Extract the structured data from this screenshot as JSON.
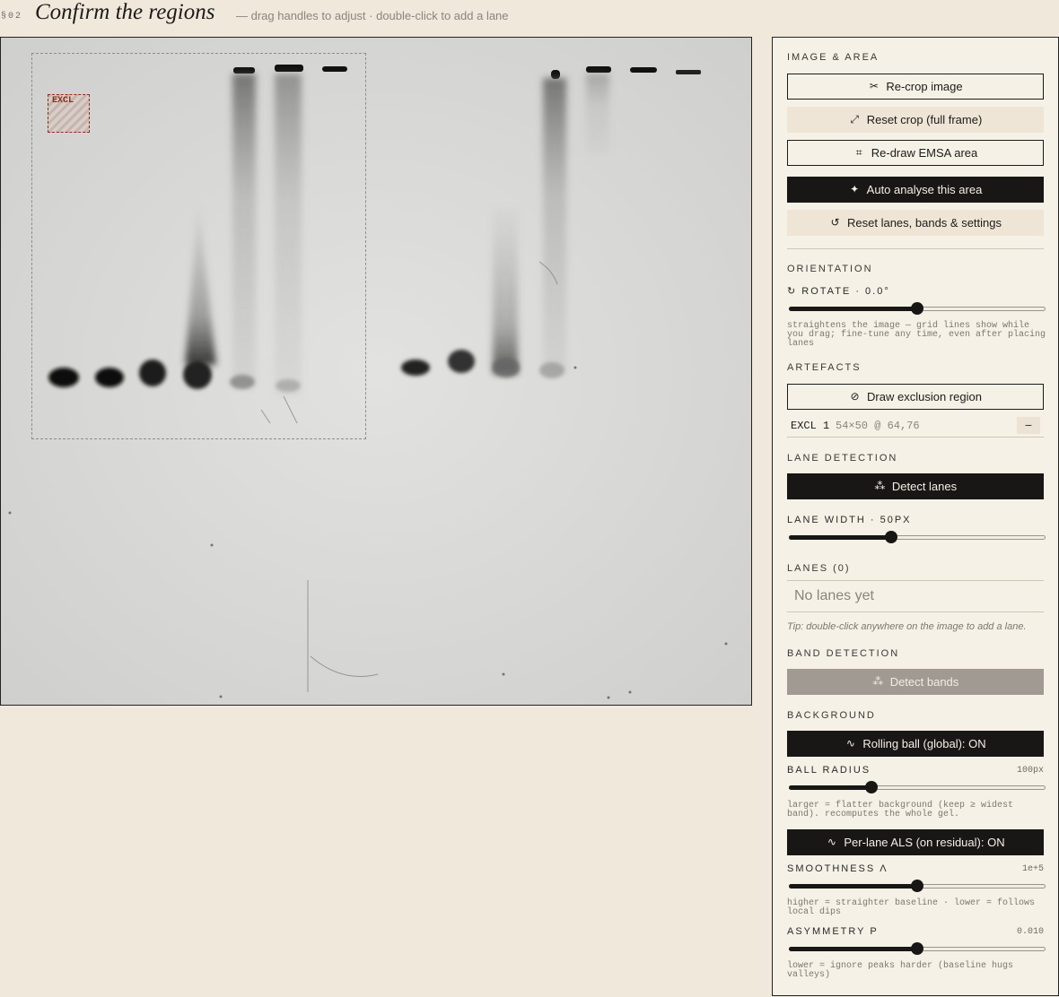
{
  "header": {
    "section": "§02",
    "title": "Confirm the regions",
    "subtitle": "— drag handles to adjust · double-click to add a lane"
  },
  "gel": {
    "exclusion_tag": "EXCL"
  },
  "panel": {
    "image_area": {
      "heading": "IMAGE & AREA",
      "recrop": "Re-crop image",
      "reset_crop": "Reset crop (full frame)",
      "redraw": "Re-draw EMSA area",
      "auto": "Auto analyse this area",
      "reset_all": "Reset lanes, bands & settings"
    },
    "orientation": {
      "heading": "ORIENTATION",
      "rotate_label": "ROTATE · 0.0°",
      "rotate_value": 0.5,
      "hint": "straightens the image — grid lines show while you drag; fine-tune any time, even after placing lanes"
    },
    "artefacts": {
      "heading": "ARTEFACTS",
      "draw_excl": "Draw exclusion region",
      "items": [
        {
          "name": "EXCL 1",
          "meta": "54×50 @ 64,76",
          "remove": "−"
        }
      ]
    },
    "lane_detection": {
      "heading": "LANE DETECTION",
      "detect": "Detect lanes",
      "width_label": "LANE WIDTH · 50PX",
      "width_value": 0.4
    },
    "lanes": {
      "heading": "LANES (0)",
      "empty": "No lanes yet",
      "tip": "Tip: double-click anywhere on the image to add a lane."
    },
    "band_detection": {
      "heading": "BAND DETECTION",
      "detect": "Detect bands"
    },
    "background": {
      "heading": "BACKGROUND",
      "rolling": "Rolling ball (global): ON",
      "ball_label": "BALL RADIUS",
      "ball_value_text": "100px",
      "ball_value": 0.32,
      "ball_hint": "larger = flatter background (keep ≥ widest band). recomputes the whole gel.",
      "als": "Per-lane ALS (on residual): ON",
      "smooth_label": "SMOOTHNESS Λ",
      "smooth_value_text": "1e+5",
      "smooth_value": 0.5,
      "smooth_hint": "higher = straighter baseline · lower = follows local dips",
      "asym_label": "ASYMMETRY P",
      "asym_value_text": "0.010",
      "asym_value": 0.5,
      "asym_hint": "lower = ignore peaks harder (baseline hugs valleys)"
    }
  }
}
